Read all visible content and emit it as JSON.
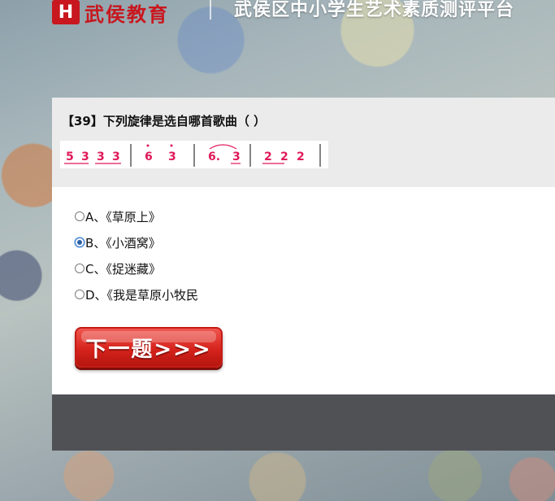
{
  "header": {
    "logo_mark": "H",
    "logo_text": "武侯教育",
    "title": "武侯区中小学生艺术素质测评平台"
  },
  "question": {
    "text": "【39】下列旋律是选自哪首歌曲（ ）",
    "score_notes": [
      "5",
      "3",
      "3",
      "3",
      "6",
      "3",
      "6.",
      "3",
      "2",
      "2",
      "2"
    ]
  },
  "options": [
    {
      "label": "A、《草原上》",
      "checked": false
    },
    {
      "label": "B、《小酒窝》",
      "checked": true
    },
    {
      "label": "C、《捉迷藏》",
      "checked": false
    },
    {
      "label": "D、《我是草原小牧民",
      "checked": false
    }
  ],
  "next_button": {
    "label": "下一题>>>"
  },
  "colors": {
    "accent": "#c8171e",
    "note_color": "#e0195a",
    "footer": "#505155"
  }
}
